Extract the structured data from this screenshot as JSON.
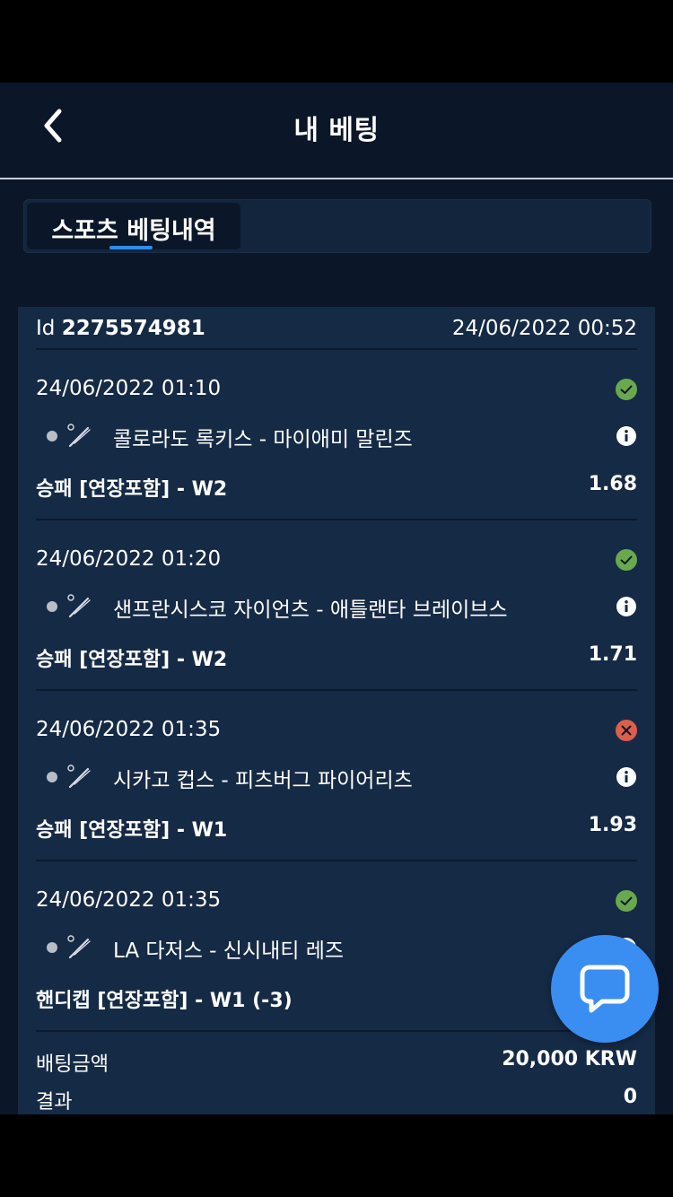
{
  "header": {
    "title": "내 베팅",
    "back": "back-icon"
  },
  "tabs": [
    {
      "label": "스포츠 베팅내역",
      "active": true
    }
  ],
  "ticket": {
    "id_label": "Id",
    "id_value": "2275574981",
    "created": "24/06/2022 00:52",
    "bets": [
      {
        "date": "24/06/2022 01:10",
        "status": "won",
        "event": "콜로라도 록키스 - 마이애미 말린즈",
        "market": "승패 [연장포함] - W2",
        "odds": "1.68"
      },
      {
        "date": "24/06/2022 01:20",
        "status": "won",
        "event": "샌프란시스코 자이언츠 - 애틀랜타 브레이브스",
        "market": "승패 [연장포함] - W2",
        "odds": "1.71"
      },
      {
        "date": "24/06/2022 01:35",
        "status": "lost",
        "event": "시카고 컵스 - 피츠버그 파이어리츠",
        "market": "승패 [연장포함] - W1",
        "odds": "1.93"
      },
      {
        "date": "24/06/2022 01:35",
        "status": "won",
        "event": "LA 다저스 - 신시내티 레즈",
        "market": "핸디캡 [연장포함] - W1 (-3)",
        "odds": ""
      }
    ],
    "stake_label": "배팅금액",
    "stake_value": "20,000 KRW",
    "result_label": "결과",
    "result_value": "0"
  },
  "colors": {
    "background": "#0b1728",
    "card": "#152a45",
    "won": "#6aa84f",
    "lost": "#d9604a",
    "accent": "#2f8bf0",
    "chat": "#3a8ef1"
  },
  "icons": {
    "won": "check-circle-icon",
    "lost": "x-circle-icon",
    "info": "info-icon",
    "sport": "baseball-bat-icon",
    "chat": "chat-bubble-icon"
  }
}
